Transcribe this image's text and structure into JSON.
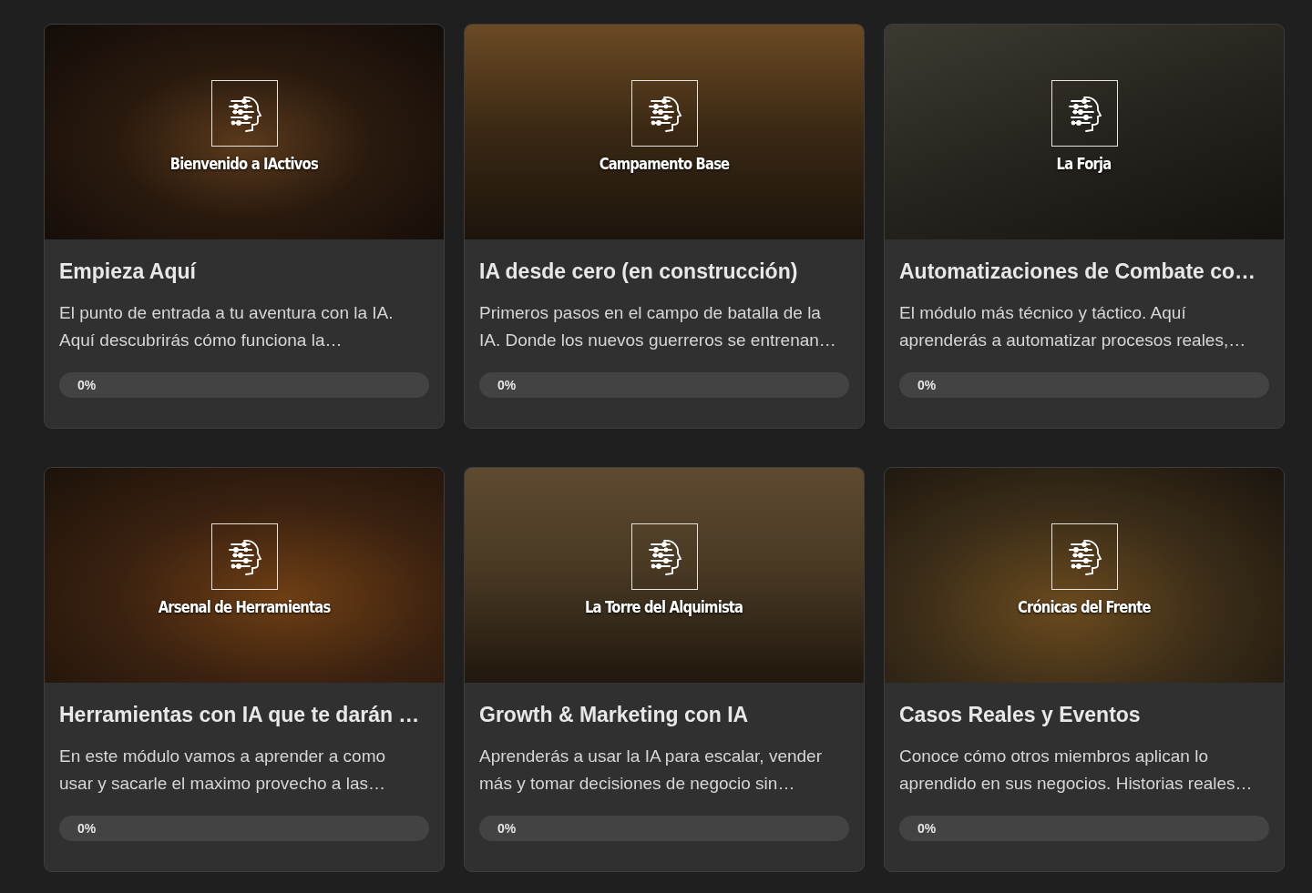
{
  "courses": [
    {
      "cover_caption": "Bienvenido a IActivos",
      "title": "Empieza Aquí",
      "description": "El punto de entrada a tu aventura con la IA. Aquí descubrirás cómo funciona la…",
      "progress": {
        "level": 0,
        "reading": "0%"
      }
    },
    {
      "cover_caption": "Campamento Base",
      "title": "IA desde cero (en construcción)",
      "description": "Primeros pasos en el campo de batalla de la IA. Donde los nuevos guerreros se entrenan…",
      "progress": {
        "level": 0,
        "reading": "0%"
      }
    },
    {
      "cover_caption": "La Forja",
      "title": "Automatizaciones de Combate co…",
      "description": "El módulo más técnico y táctico. Aquí aprenderás a automatizar procesos reales,…",
      "progress": {
        "level": 0,
        "reading": "0%"
      }
    },
    {
      "cover_caption": "Arsenal de Herramientas",
      "title": "Herramientas con IA que te darán …",
      "description": "En este módulo vamos a aprender a como usar y sacarle el maximo provecho a las…",
      "progress": {
        "level": 0,
        "reading": "0%"
      }
    },
    {
      "cover_caption": "La Torre del Alquimista",
      "title": "Growth & Marketing con IA",
      "description": "Aprenderás a usar la IA para escalar, vender más y tomar decisiones de negocio sin…",
      "progress": {
        "level": 0,
        "reading": "0%"
      }
    },
    {
      "cover_caption": "Crónicas del Frente",
      "title": "Casos Reales y Eventos",
      "description": "Conoce cómo otros miembros aplican lo aprendido en sus negocios. Historias reales…",
      "progress": {
        "level": 0,
        "reading": "0%"
      }
    }
  ]
}
